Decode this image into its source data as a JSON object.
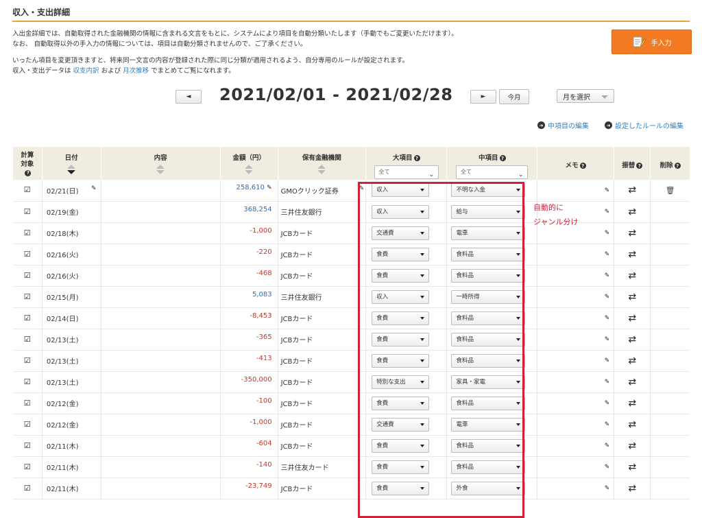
{
  "page": {
    "title": "収入・支出詳細",
    "intro_lines": [
      "入出金詳細では、自動取得された金融機関の情報に含まれる文言をもとに、システムにより項目を自動分類いたします（手動でもご変更いただけます）。",
      "なお、 自動取得以外の手入力の情報については、項目は自動分類されませんので、ご了承ください。"
    ],
    "rule_line": "いったん項目を変更頂きますと、将来同一文言の内容が登録された際に同じ分類が適用されるよう、自分専用のルールが設定されます。",
    "summary_prefix": "収入・支出データは ",
    "summary_link1": "収支内訳",
    "summary_mid": " および ",
    "summary_link2": "月次推移",
    "summary_suffix": " でまとめてご覧になれます。",
    "manual_button": "手入力"
  },
  "date_nav": {
    "prev": "◄",
    "range": "2021/02/01 - 2021/02/28",
    "next": "►",
    "today": "今月",
    "month_select": "月を選択"
  },
  "links": {
    "edit_mid_category": "中項目の編集",
    "edit_rules": "設定したルールの編集"
  },
  "table": {
    "headers": {
      "calc1": "計算",
      "calc2": "対象",
      "date": "日付",
      "content": "内容",
      "amount": "金額（円）",
      "institution": "保有金融機関",
      "large_cat": "大項目",
      "mid_cat": "中項目",
      "memo": "メモ",
      "transfer": "振替",
      "delete": "削除"
    },
    "filter_all": "全て",
    "rows": [
      {
        "date": "02/21(日)",
        "amount": "258,610",
        "institution": "GMOクリック証券",
        "large": "収入",
        "mid": "不明な入金",
        "sign": "plus"
      },
      {
        "date": "02/19(金)",
        "amount": "368,254",
        "institution": "三井住友銀行",
        "large": "収入",
        "mid": "給与",
        "sign": "plus"
      },
      {
        "date": "02/18(木)",
        "amount": "-1,000",
        "institution": "JCBカード",
        "large": "交通費",
        "mid": "電車",
        "sign": "minus"
      },
      {
        "date": "02/16(火)",
        "amount": "-220",
        "institution": "JCBカード",
        "large": "食費",
        "mid": "食料品",
        "sign": "minus"
      },
      {
        "date": "02/16(火)",
        "amount": "-468",
        "institution": "JCBカード",
        "large": "食費",
        "mid": "食料品",
        "sign": "minus"
      },
      {
        "date": "02/15(月)",
        "amount": "5,083",
        "institution": "三井住友銀行",
        "large": "収入",
        "mid": "一時所得",
        "sign": "plus"
      },
      {
        "date": "02/14(日)",
        "amount": "-8,453",
        "institution": "JCBカード",
        "large": "食費",
        "mid": "食料品",
        "sign": "minus"
      },
      {
        "date": "02/13(土)",
        "amount": "-365",
        "institution": "JCBカード",
        "large": "食費",
        "mid": "食料品",
        "sign": "minus"
      },
      {
        "date": "02/13(土)",
        "amount": "-413",
        "institution": "JCBカード",
        "large": "食費",
        "mid": "食料品",
        "sign": "minus"
      },
      {
        "date": "02/13(土)",
        "amount": "-350,000",
        "institution": "JCBカード",
        "large": "特別な支出",
        "mid": "家具・家電",
        "sign": "minus"
      },
      {
        "date": "02/12(金)",
        "amount": "-100",
        "institution": "JCBカード",
        "large": "食費",
        "mid": "食料品",
        "sign": "minus"
      },
      {
        "date": "02/12(金)",
        "amount": "-1,000",
        "institution": "JCBカード",
        "large": "交通費",
        "mid": "電車",
        "sign": "minus"
      },
      {
        "date": "02/11(木)",
        "amount": "-604",
        "institution": "JCBカード",
        "large": "食費",
        "mid": "食料品",
        "sign": "minus"
      },
      {
        "date": "02/11(木)",
        "amount": "-140",
        "institution": "三井住友カード",
        "large": "食費",
        "mid": "食料品",
        "sign": "minus"
      },
      {
        "date": "02/11(木)",
        "amount": "-23,749",
        "institution": "JCBカード",
        "large": "食費",
        "mid": "外食",
        "sign": "minus"
      }
    ]
  },
  "annotation": {
    "line1": "自動的に",
    "line2": "ジャンル分け"
  },
  "colors": {
    "accent": "#e8a33a",
    "button": "#f27a22",
    "highlight_box": "#d0213a",
    "link": "#2f7fc1",
    "income": "#2f6fb5",
    "expense": "#c0392b"
  }
}
